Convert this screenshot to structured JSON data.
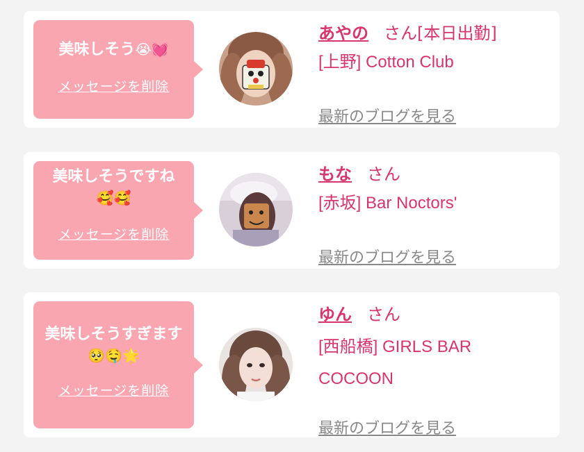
{
  "posts": [
    {
      "message": "美味しそう",
      "emojis": "😭💓",
      "delete_label": "メッセージを削除",
      "name": "あやの",
      "san": "さん",
      "status": "[本日出勤]",
      "shop": "[上野] Cotton Club",
      "blog_link": "最新のブログを見る"
    },
    {
      "message": "美味しそうですね",
      "emojis": "🥰🥰",
      "delete_label": "メッセージを削除",
      "name": "もな",
      "san": "さん",
      "shop": "[赤坂] Bar Noctors'",
      "blog_link": "最新のブログを見る"
    },
    {
      "message": "美味しそうすぎます",
      "emojis": "🥺🤤🌟",
      "delete_label": "メッセージを削除",
      "name": "ゆん",
      "san": "さん",
      "shop_line1": "[西船橋] GIRLS BAR",
      "shop_line2": "COCOON",
      "blog_link": "最新のブログを見る"
    }
  ],
  "colors": {
    "accent": "#d6356e",
    "bubble": "#f9a6b1",
    "background": "#f3f3f3",
    "link_gray": "#888888"
  }
}
